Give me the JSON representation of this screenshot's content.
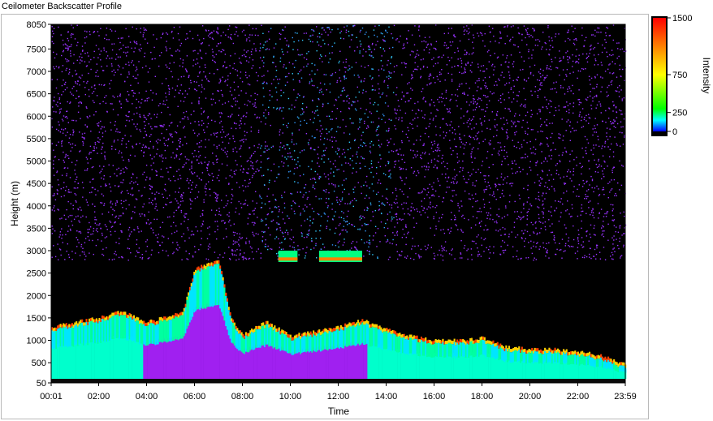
{
  "window": {
    "title": "Ceilometer Backscatter Profile"
  },
  "chart_data": {
    "type": "heatmap",
    "title": "Ceilometer Backscatter Profile",
    "xlabel": "Time",
    "ylabel": "Height (m)",
    "x_ticks": [
      "00:01",
      "02:00",
      "04:00",
      "06:00",
      "08:00",
      "10:00",
      "12:00",
      "14:00",
      "16:00",
      "18:00",
      "20:00",
      "22:00",
      "23:59"
    ],
    "x_tick_hours": [
      0.0167,
      2,
      4,
      6,
      8,
      10,
      12,
      14,
      16,
      18,
      20,
      22,
      23.983
    ],
    "x_range_hours": [
      0.0167,
      23.983
    ],
    "y_ticks": [
      50,
      500,
      1000,
      1500,
      2000,
      2500,
      3000,
      3500,
      4000,
      4500,
      5000,
      5500,
      6000,
      6500,
      7000,
      7500,
      8050
    ],
    "ylim": [
      50,
      8050
    ],
    "colorbar": {
      "label": "Intensity",
      "ticks": [
        0,
        250,
        750,
        1500
      ],
      "range": [
        0,
        1500
      ],
      "colors": [
        "#0000ff",
        "#00ffff",
        "#00ff00",
        "#ffff00",
        "#ff8000",
        "#ff0000"
      ]
    },
    "background_color": "#000000",
    "noise_color": "#9933ff",
    "cloud_layer_top_m": [
      [
        0.0,
        1300
      ],
      [
        1.0,
        1400
      ],
      [
        2.0,
        1500
      ],
      [
        3.0,
        1650
      ],
      [
        4.0,
        1400
      ],
      [
        5.0,
        1550
      ],
      [
        5.5,
        1650
      ],
      [
        6.0,
        2600
      ],
      [
        7.0,
        2800
      ],
      [
        7.5,
        1500
      ],
      [
        8.0,
        1100
      ],
      [
        8.5,
        1300
      ],
      [
        9.0,
        1400
      ],
      [
        10.0,
        1100
      ],
      [
        11.0,
        1200
      ],
      [
        12.0,
        1300
      ],
      [
        13.0,
        1450
      ],
      [
        14.0,
        1250
      ],
      [
        15.0,
        1100
      ],
      [
        16.0,
        1000
      ],
      [
        17.0,
        1000
      ],
      [
        18.0,
        1050
      ],
      [
        19.0,
        850
      ],
      [
        20.0,
        800
      ],
      [
        21.0,
        800
      ],
      [
        22.0,
        750
      ],
      [
        23.0,
        650
      ],
      [
        23.98,
        450
      ]
    ],
    "upper_cloud_patches": [
      {
        "start_hour": 9.5,
        "end_hour": 10.3,
        "height_m": 2850
      },
      {
        "start_hour": 11.2,
        "end_hour": 13.0,
        "height_m": 2850
      }
    ]
  }
}
